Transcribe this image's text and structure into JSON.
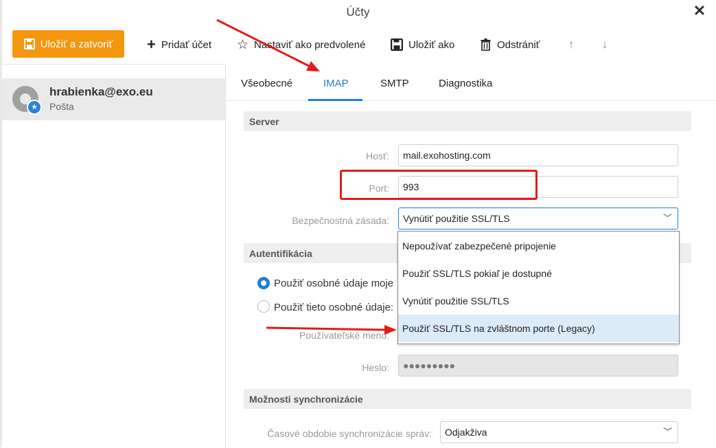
{
  "window": {
    "title": "Účty"
  },
  "toolbar": {
    "save_close": "Uložiť a zatvoriť",
    "add_account": "Pridať účet",
    "set_default": "Nastaviť ako predvolené",
    "save_as": "Uložiť ako",
    "delete": "Odstrániť"
  },
  "account": {
    "email": "hrabienka@exo.eu",
    "type": "Pošta"
  },
  "tabs": [
    {
      "label": "Všeobecné",
      "active": false
    },
    {
      "label": "IMAP",
      "active": true
    },
    {
      "label": "SMTP",
      "active": false
    },
    {
      "label": "Diagnostika",
      "active": false
    }
  ],
  "server": {
    "section_title": "Server",
    "host_label": "Hosť:",
    "host_value": "mail.exohosting.com",
    "port_label": "Port:",
    "port_value": "993",
    "security_label": "Bezpečnostná zásada:",
    "security_value": "Vynútiť použitie SSL/TLS"
  },
  "security_options": [
    "Nepoužívať zabezpečené pripojenie",
    "Použiť SSL/TLS pokiaľ je dostupné",
    "Vynútiť použitie SSL/TLS",
    "Použiť SSL/TLS na zvláštnom porte (Legacy)"
  ],
  "auth": {
    "section_title": "Autentifikácia",
    "option1": "Použiť osobné údaje moje",
    "option2": "Použiť tieto osobné údaje:",
    "username_label": "Používateľské meno:",
    "password_label": "Heslo:",
    "password_value": "●●●●●●●●●"
  },
  "sync": {
    "section_title": "Možnosti synchronizácie",
    "period_label": "Časové obdobie synchronizácie správ:",
    "period_value": "Odjakživa"
  },
  "colors": {
    "accent": "#1c7fd6",
    "primary_button": "#f5960f",
    "annotation": "#e21b1b"
  }
}
